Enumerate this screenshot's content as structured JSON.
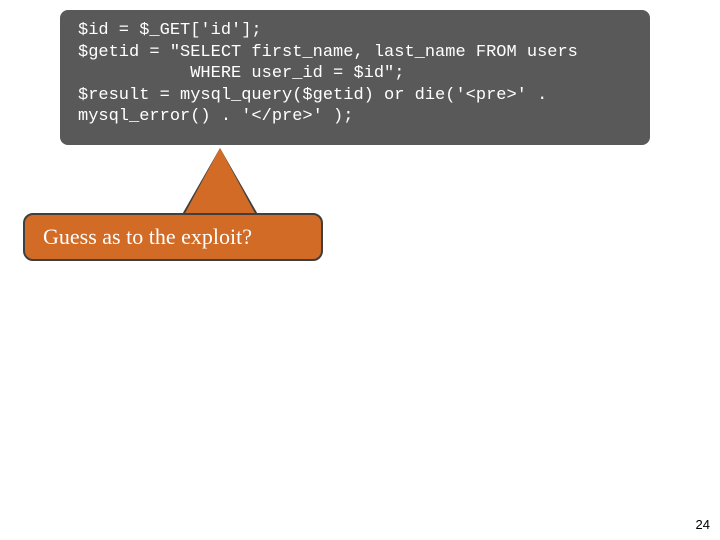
{
  "code_lines": [
    "$id = $_GET['id'];",
    "$getid = \"SELECT first_name, last_name FROM users",
    "           WHERE user_id = $id\";",
    "$result = mysql_query($getid) or die('<pre>' .",
    "mysql_error() . '</pre>' );"
  ],
  "callout_text": "Guess as to the exploit?",
  "page_number": "24"
}
